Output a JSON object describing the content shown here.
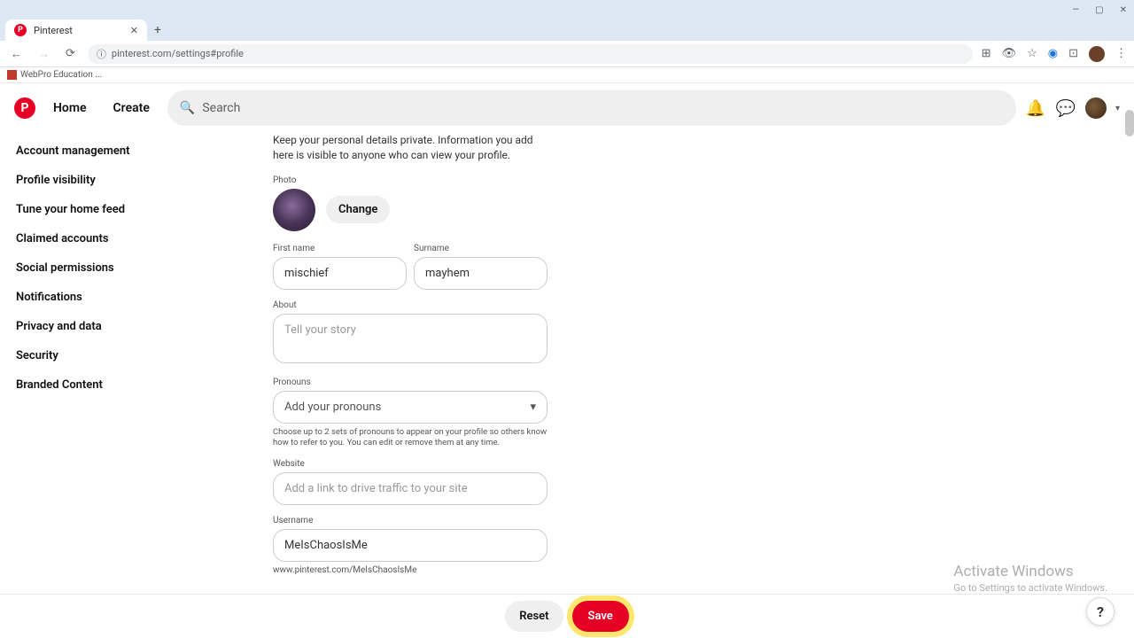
{
  "browser": {
    "tab_title": "Pinterest",
    "url": "pinterest.com/settings#profile",
    "bookmark": "WebPro Education ..."
  },
  "header": {
    "home": "Home",
    "create": "Create",
    "search_placeholder": "Search"
  },
  "sidebar": {
    "items": [
      {
        "label": "Account management"
      },
      {
        "label": "Profile visibility"
      },
      {
        "label": "Tune your home feed"
      },
      {
        "label": "Claimed accounts"
      },
      {
        "label": "Social permissions"
      },
      {
        "label": "Notifications"
      },
      {
        "label": "Privacy and data"
      },
      {
        "label": "Security"
      },
      {
        "label": "Branded Content"
      }
    ]
  },
  "form": {
    "intro": "Keep your personal details private. Information you add here is visible to anyone who can view your profile.",
    "photo_label": "Photo",
    "change": "Change",
    "first_name_label": "First name",
    "first_name_value": "mischief",
    "surname_label": "Surname",
    "surname_value": "mayhem",
    "about_label": "About",
    "about_placeholder": "Tell your story",
    "pronouns_label": "Pronouns",
    "pronouns_placeholder": "Add your pronouns",
    "pronouns_help": "Choose up to 2 sets of pronouns to appear on your profile so others know how to refer to you. You can edit or remove them at any time.",
    "website_label": "Website",
    "website_placeholder": "Add a link to drive traffic to your site",
    "username_label": "Username",
    "username_value": "MeIsChaosIsMe",
    "username_url": "www.pinterest.com/MeIsChaosIsMe"
  },
  "footer": {
    "reset": "Reset",
    "save": "Save"
  },
  "overlay": {
    "activate_title": "Activate Windows",
    "activate_sub": "Go to Settings to activate Windows."
  }
}
